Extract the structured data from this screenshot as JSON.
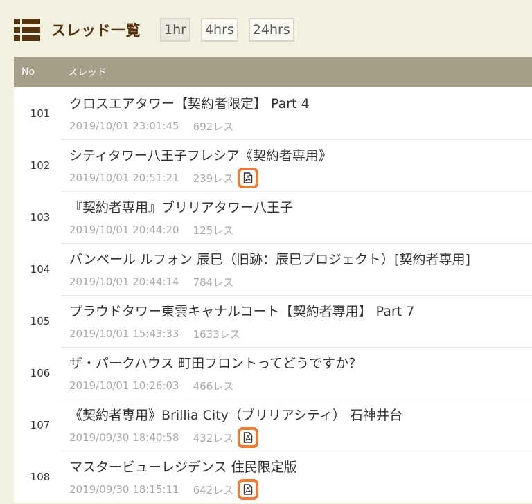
{
  "header": {
    "title": "スレッド一覧",
    "ranges": [
      "1hr",
      "4hrs",
      "24hrs"
    ]
  },
  "table": {
    "headers": {
      "no": "No",
      "thread": "スレッド"
    },
    "rows": [
      {
        "no": "101",
        "title": "クロスエアタワー【契約者限定】 Part 4",
        "date": "2019/10/01 23:01:45",
        "count": "692レス",
        "pdf": false
      },
      {
        "no": "102",
        "title": "シティタワー八王子フレシア《契約者専用》",
        "date": "2019/10/01 20:51:21",
        "count": "239レス",
        "pdf": true
      },
      {
        "no": "103",
        "title": "『契約者専用』ブリリアタワー八王子",
        "date": "2019/10/01 20:44:20",
        "count": "125レス",
        "pdf": false
      },
      {
        "no": "104",
        "title": "バンベール ルフォン 辰巳（旧跡：辰巳プロジェクト）[契約者専用]",
        "date": "2019/10/01 20:44:14",
        "count": "784レス",
        "pdf": false
      },
      {
        "no": "105",
        "title": "プラウドタワー東雲キャナルコート【契約者専用】 Part 7",
        "date": "2019/10/01 15:43:33",
        "count": "1633レス",
        "pdf": false
      },
      {
        "no": "106",
        "title": "ザ・パークハウス 町田フロントってどうですか？",
        "date": "2019/10/01 10:26:03",
        "count": "466レス",
        "pdf": false
      },
      {
        "no": "107",
        "title": "《契約者専用》Brillia City（ブリリアシティ） 石神井台",
        "date": "2019/09/30 18:40:58",
        "count": "432レス",
        "pdf": true
      },
      {
        "no": "108",
        "title": "マスタービューレジデンス 住民限定版",
        "date": "2019/09/30 18:15:11",
        "count": "642レス",
        "pdf": true
      }
    ]
  },
  "colors": {
    "brand": "#56320f",
    "header_bg": "#a59f8a",
    "page_bg": "#f3f1df",
    "pdf_accent": "#ee7b36"
  },
  "icons": {
    "list": "list-icon",
    "pdf": "pdf-icon"
  }
}
